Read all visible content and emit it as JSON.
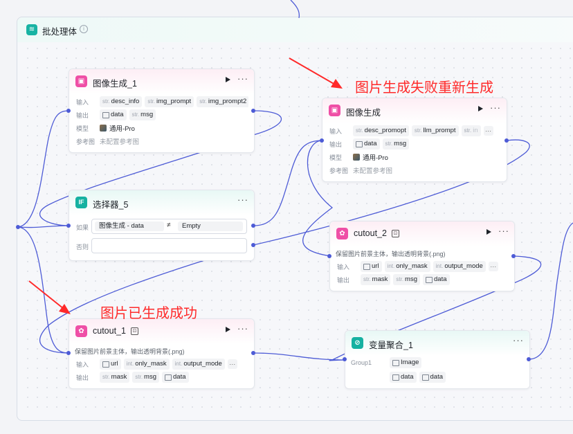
{
  "colors": {
    "wire": "#4d5bd6",
    "accent_pink": "#ef4fa6",
    "accent_teal": "#16b1a1",
    "annotation": "#ff2a2a"
  },
  "batch": {
    "title": "批处理体",
    "icon": "layers-icon",
    "info_icon": "info-icon"
  },
  "node_img1": {
    "title": "图像生成_1",
    "labels": {
      "input": "输入",
      "output": "输出",
      "model": "模型",
      "ref": "参考图"
    },
    "inputs": [
      {
        "type": "str.",
        "name": "desc_info"
      },
      {
        "type": "str.",
        "name": "img_prompt"
      },
      {
        "type": "str.",
        "name": "img_prompt2"
      }
    ],
    "outputs": [
      {
        "type": "img",
        "name": "data"
      },
      {
        "type": "str.",
        "name": "msg"
      }
    ],
    "model": "通用-Pro",
    "ref": "未配置参考图"
  },
  "node_img": {
    "title": "图像生成",
    "labels": {
      "input": "输入",
      "output": "输出",
      "model": "模型",
      "ref": "参考图"
    },
    "inputs": [
      {
        "type": "str.",
        "name": "desc_promopt"
      },
      {
        "type": "str.",
        "name": "llm_prompt"
      },
      {
        "type": "str.",
        "name": "in"
      }
    ],
    "more": "···",
    "outputs": [
      {
        "type": "img",
        "name": "data"
      },
      {
        "type": "str.",
        "name": "msg"
      }
    ],
    "model": "通用-Pro",
    "ref": "未配置参考图"
  },
  "node_selector": {
    "title": "选择器_5",
    "icon_text": "IF",
    "if_label": "如果",
    "else_label": "否则",
    "cond": {
      "left": "图像生成  -  data",
      "op": "≠",
      "right": "Empty"
    }
  },
  "node_cutout2": {
    "title": "cutout_2",
    "desc": "保留图片前景主体，输出透明背景(.png)",
    "labels": {
      "input": "输入",
      "output": "输出"
    },
    "inputs": [
      {
        "type": "img",
        "name": "url"
      },
      {
        "type": "int.",
        "name": "only_mask"
      },
      {
        "type": "int.",
        "name": "output_mode"
      }
    ],
    "more": "···",
    "outputs": [
      {
        "type": "str.",
        "name": "mask"
      },
      {
        "type": "str.",
        "name": "msg"
      },
      {
        "type": "img",
        "name": "data"
      }
    ]
  },
  "node_cutout1": {
    "title": "cutout_1",
    "desc": "保留图片前景主体，输出透明背景(.png)",
    "labels": {
      "input": "输入",
      "output": "输出"
    },
    "inputs": [
      {
        "type": "img",
        "name": "url"
      },
      {
        "type": "int.",
        "name": "only_mask"
      },
      {
        "type": "int.",
        "name": "output_mode"
      }
    ],
    "more": "···",
    "outputs": [
      {
        "type": "str.",
        "name": "mask"
      },
      {
        "type": "str.",
        "name": "msg"
      },
      {
        "type": "img",
        "name": "data"
      }
    ]
  },
  "node_agg": {
    "title": "变量聚合_1",
    "group_label": "Group1",
    "items": [
      {
        "type": "img",
        "name": "Image"
      }
    ],
    "items2": [
      {
        "type": "img",
        "name": "data"
      },
      {
        "type": "img",
        "name": "data"
      }
    ]
  },
  "annotations": {
    "regen": "图片生成失败重新生成",
    "success": "图片已生成成功"
  },
  "menu_glyph": "···"
}
